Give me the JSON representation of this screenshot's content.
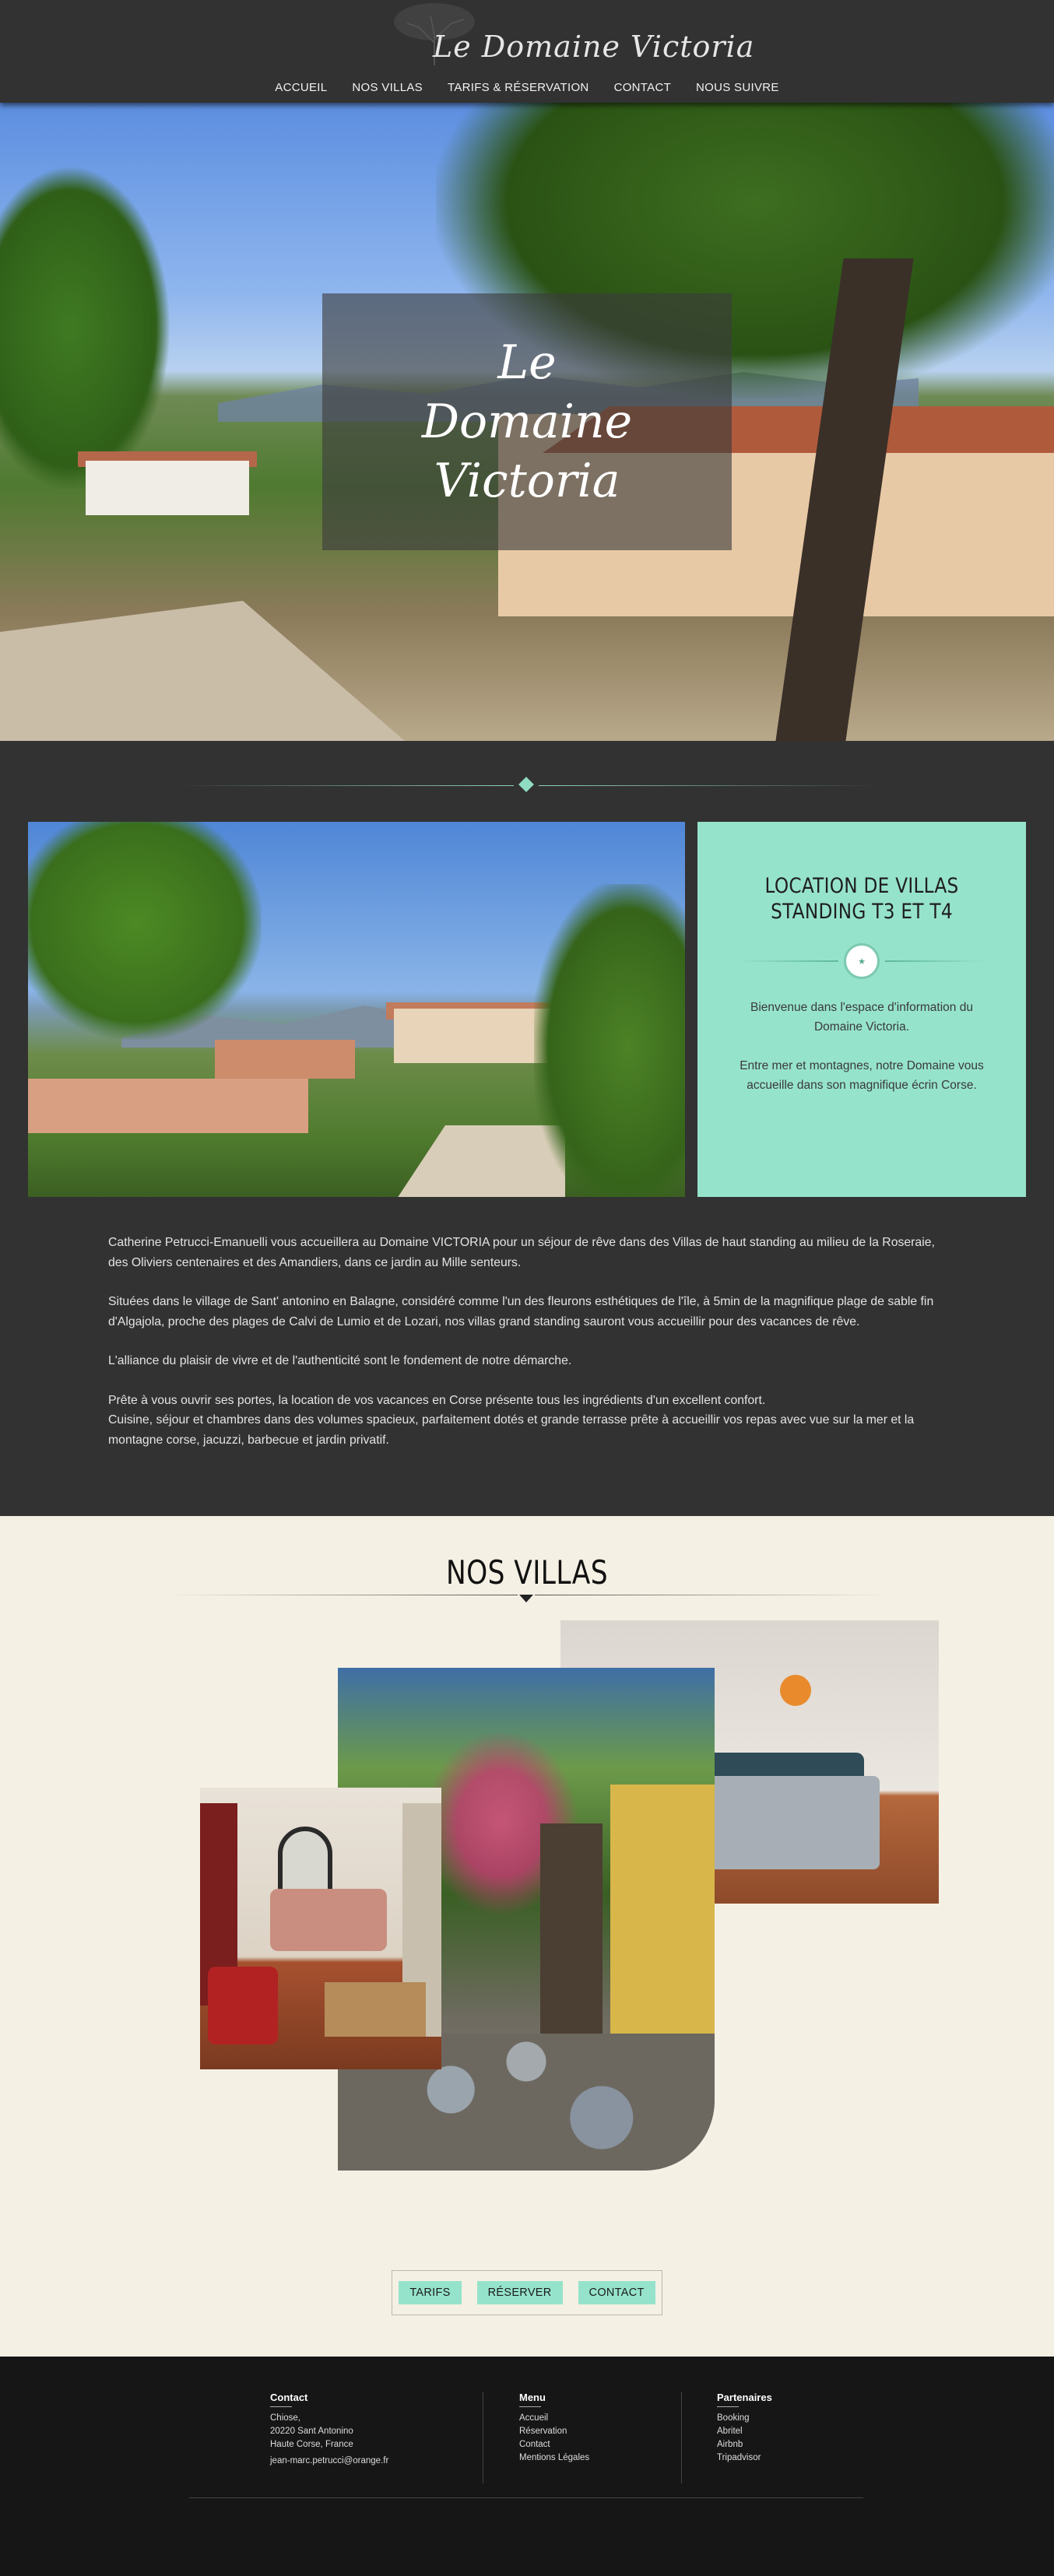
{
  "header": {
    "logo_text": "Le Domaine Victoria",
    "nav": [
      "ACCUEIL",
      "NOS VILLAS",
      "TARIFS & RÉSERVATION",
      "CONTACT",
      "NOUS SUIVRE"
    ]
  },
  "hero": {
    "title_lines": [
      "Le",
      "Domaine",
      "Victoria"
    ]
  },
  "info_card": {
    "title_line1": "LOCATION DE VILLAS",
    "title_line2": "STANDING T3 ET T4",
    "p1": "Bienvenue dans l'espace d'information du Domaine Victoria.",
    "p2": "Entre mer et montagnes, notre Domaine vous accueille dans son magnifique écrin Corse."
  },
  "intro": {
    "p1": "Catherine Petrucci-Emanuelli vous accueillera au Domaine VICTORIA pour un séjour de rêve dans des Villas de haut standing au milieu de la Roseraie, des Oliviers centenaires et des Amandiers, dans ce jardin au Mille senteurs.",
    "p2": "Situées dans le village de Sant' antonino en Balagne, considéré comme l'un des fleurons esthétiques de l'île, à 5min de la magnifique plage de sable fin d'Algajola, proche des plages de Calvi de Lumio et de Lozari, nos villas grand standing sauront vous accueillir pour des vacances de rêve.",
    "p3": "L'alliance du plaisir de vivre et de l'authenticité sont le fondement de notre démarche.",
    "p4a": "Prête à vous ouvrir ses portes, la location de vos vacances en Corse présente tous les ingrédients d'un excellent confort.",
    "p4b": "Cuisine, séjour et chambres dans des volumes spacieux, parfaitement dotés et grande terrasse prête à accueillir vos repas avec vue sur la mer et la montagne corse, jacuzzi, barbecue et jardin privatif."
  },
  "villas": {
    "title": "NOS VILLAS",
    "buttons": [
      "TARIFS",
      "RÉSERVER",
      "CONTACT"
    ]
  },
  "footer": {
    "contact": {
      "title": "Contact",
      "lines": [
        "Chiose,",
        "20220 Sant Antonino",
        "Haute Corse, France"
      ],
      "email": "jean-marc.petrucci@orange.fr"
    },
    "menu": {
      "title": "Menu",
      "items": [
        "Accueil",
        "Réservation",
        "Contact",
        "Mentions Légales"
      ]
    },
    "partners": {
      "title": "Partenaires",
      "items": [
        "Booking",
        "Abritel",
        "Airbnb",
        "Tripadvisor"
      ]
    }
  },
  "colors": {
    "accent": "#96e3cb",
    "dark_bg": "#323232",
    "cream_bg": "#f5f0e4",
    "footer_bg": "#161616"
  }
}
